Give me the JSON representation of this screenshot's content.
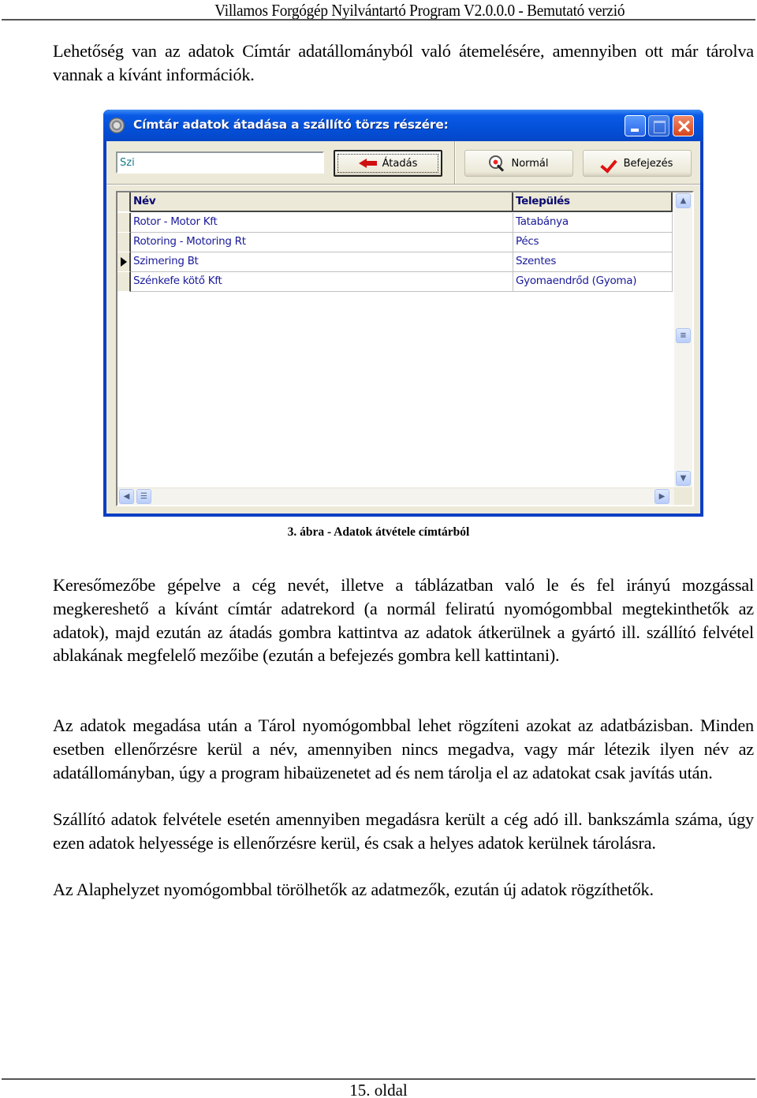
{
  "header": {
    "title": "Villamos Forgógép Nyilvántartó Program V2.0.0.0 - Bemutató verzió"
  },
  "intro_paragraph": "Lehetőség van az adatok Címtár adatállományból való átemelésére, amennyiben ott már tárolva vannak a kívánt információk.",
  "window": {
    "title": "Címtár adatok átadása a szállító törzs részére:",
    "search_value": "Szi",
    "buttons": {
      "transfer": "Átadás",
      "normal": "Normál",
      "finish": "Befejezés"
    },
    "icons": {
      "app": "gear-icon",
      "transfer": "arrow-left-icon",
      "normal": "magnifier-icon",
      "finish": "checkmark-icon",
      "minimize": "minimize-icon",
      "maximize": "maximize-icon",
      "close": "close-icon"
    },
    "grid": {
      "columns": [
        "Név",
        "Település"
      ],
      "rows": [
        {
          "name": "Rotor - Motor Kft",
          "city": "Tatabánya",
          "current": false
        },
        {
          "name": "Rotoring - Motoring Rt",
          "city": "Pécs",
          "current": false
        },
        {
          "name": "Szimering Bt",
          "city": "Szentes",
          "current": true
        },
        {
          "name": "Szénkefe kötő Kft",
          "city": "Gyomaendrőd (Gyoma)",
          "current": false
        }
      ]
    },
    "colors": {
      "title_bar": "#0450d8",
      "body": "#ece9d8",
      "grid_text": "#1a1a9a",
      "close_button": "#d6451c"
    }
  },
  "figure_caption": "3. ábra - Adatok átvétele címtárból",
  "paragraphs": [
    "Keresőmezőbe gépelve a cég nevét, illetve a táblázatban való le és fel irányú mozgással megkereshető a kívánt címtár adatrekord (a normál feliratú nyomógombbal megtekinthetők az adatok), majd ezután az átadás gombra kattintva az adatok átkerülnek a gyártó ill. szállító felvétel ablakának megfelelő mezőibe (ezután a befejezés gombra kell kattintani).",
    "Az adatok megadása után a Tárol nyomógombbal lehet rögzíteni azokat az adatbázisban. Minden esetben ellenőrzésre kerül a név, amennyiben nincs megadva, vagy már létezik ilyen név az adatállományban, úgy a program hibaüzenetet ad és nem tárolja el az adatokat csak javítás után.",
    "Szállító adatok felvétele esetén amennyiben megadásra került a cég adó ill. bankszámla száma, úgy ezen adatok helyessége is ellenőrzésre kerül, és csak a helyes adatok kerülnek tárolásra.",
    "Az Alaphelyzet nyomógombbal törölhetők az adatmezők, ezután új adatok rögzíthetők."
  ],
  "footer": {
    "page": "15. oldal"
  }
}
